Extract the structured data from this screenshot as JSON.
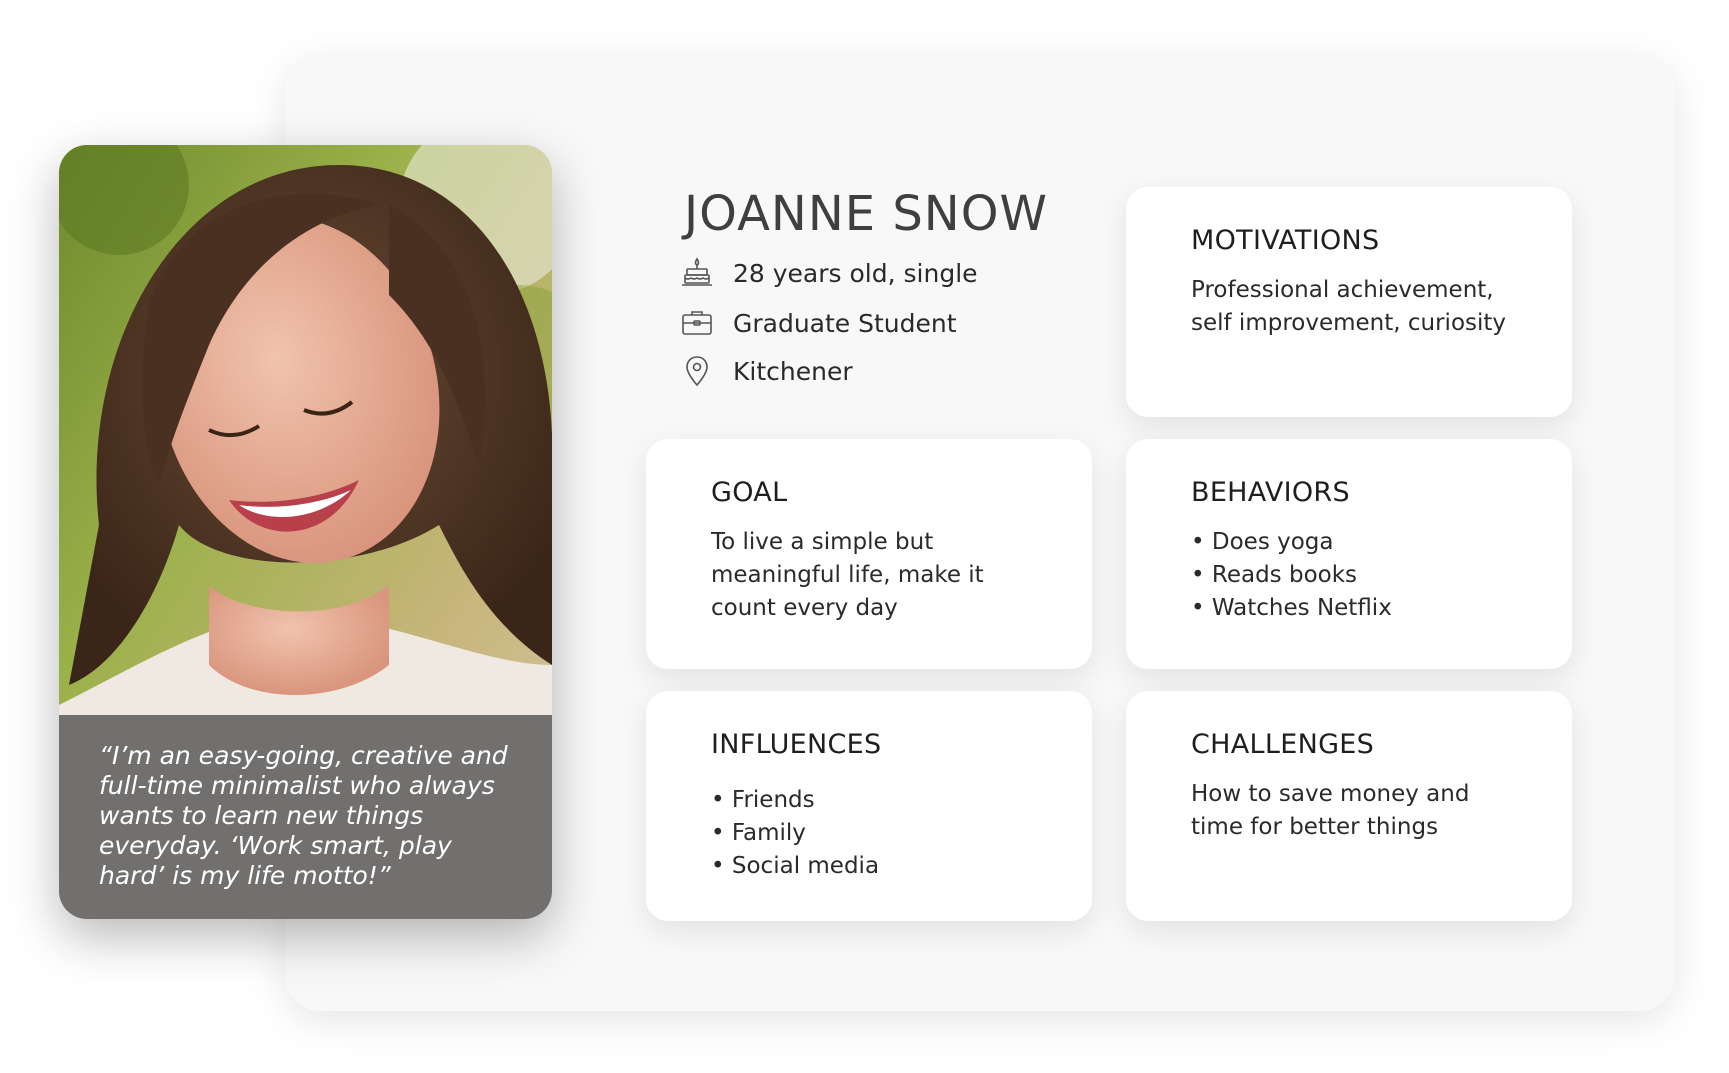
{
  "persona": {
    "name": "JOANNE SNOW",
    "quote": "“I’m an easy-going, creative and full-time minimalist who always wants to learn new things everyday. ‘Work smart, play hard’ is my life motto!”",
    "details": {
      "age": {
        "icon": "birthday-cake-icon",
        "text": "28 years old, single"
      },
      "occupation": {
        "icon": "briefcase-icon",
        "text": "Graduate Student"
      },
      "location": {
        "icon": "map-pin-icon",
        "text": "Kitchener"
      }
    }
  },
  "cards": {
    "motivations": {
      "title": "MOTIVATIONS",
      "body": "Professional achievement,\nself improvement, curiosity"
    },
    "goal": {
      "title": "GOAL",
      "body": "To live a simple but\nmeaningful life, make it\ncount every day"
    },
    "behaviors": {
      "title": "BEHAVIORS",
      "items": [
        "Does yoga",
        "Reads books",
        "Watches Netflix"
      ]
    },
    "influences": {
      "title": "INFLUENCES",
      "items": [
        "Friends",
        "Family",
        "Social media"
      ]
    },
    "challenges": {
      "title": "CHALLENGES",
      "body": "How to save money and\ntime for better things"
    }
  },
  "colors": {
    "panel_bg": "#f8f8f8",
    "card_bg": "#ffffff",
    "quote_overlay": "#5c5c5c",
    "name_text": "#3f3f3f",
    "icon_stroke": "#555555"
  }
}
